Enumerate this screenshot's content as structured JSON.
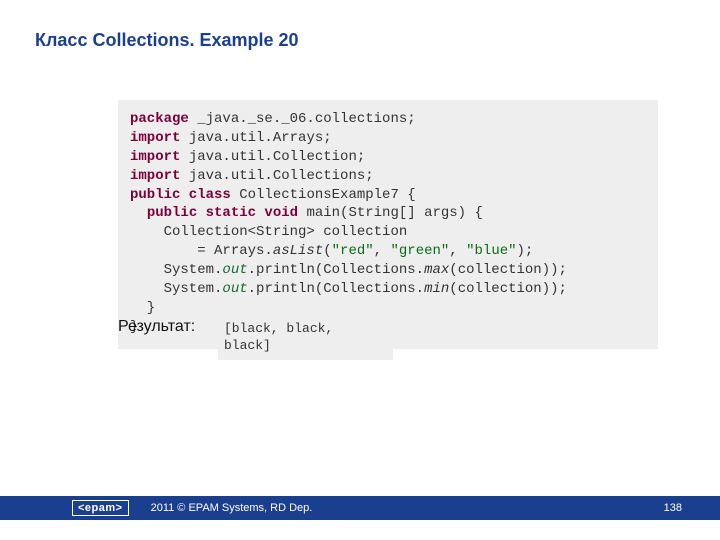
{
  "title": "Класс  Collections. Example 20",
  "code": {
    "l1": {
      "kw": "package",
      "rest": " _java._se._06.collections;"
    },
    "l2": {
      "kw": "import",
      "rest": " java.util.Arrays;"
    },
    "l3": {
      "kw": "import",
      "rest": " java.util.Collection;"
    },
    "l4": {
      "kw": "import",
      "rest": " java.util.Collections;"
    },
    "l5": {
      "kw1": "public class",
      "cls": " CollectionsExample7 {"
    },
    "l6": {
      "pad": "  ",
      "kw1": "public static void",
      "rest": " main(String[] args) {"
    },
    "l7": "    Collection<String> collection",
    "l8": {
      "pad": "        = Arrays.",
      "m": "asList",
      "open": "(",
      "s1": "\"red\"",
      "c1": ", ",
      "s2": "\"green\"",
      "c2": ", ",
      "s3": "\"blue\"",
      "end": ");"
    },
    "l9": {
      "pad": "    System.",
      "out": "out",
      "mid": ".println(Collections.",
      "m": "max",
      "end": "(collection));"
    },
    "l10": {
      "pad": "    System.",
      "out": "out",
      "mid": ".println(Collections.",
      "m": "min",
      "end": "(collection));"
    },
    "l11": "  }",
    "l12": "}"
  },
  "result_label": "Результат:",
  "result_output": {
    "line1": "[black, black,",
    "line2": "black]"
  },
  "footer": {
    "logo": "<epam>",
    "copyright": "2011 © EPAM Systems, RD Dep.",
    "page": "138"
  }
}
